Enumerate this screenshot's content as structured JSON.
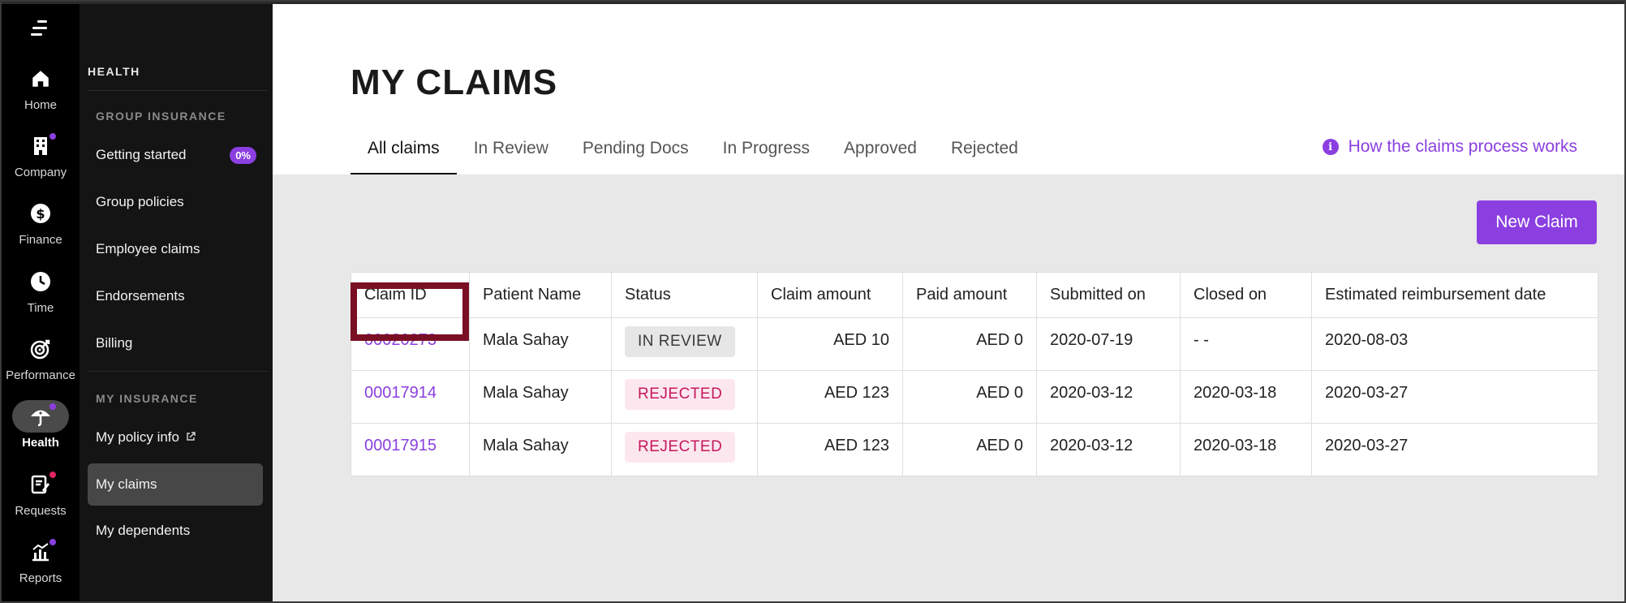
{
  "rail": {
    "items": [
      {
        "label": "Home",
        "icon": "home-icon",
        "dot": ""
      },
      {
        "label": "Company",
        "icon": "building-icon",
        "dot": "#8b3fe0"
      },
      {
        "label": "Finance",
        "icon": "dollar-icon",
        "dot": ""
      },
      {
        "label": "Time",
        "icon": "clock-icon",
        "dot": ""
      },
      {
        "label": "Performance",
        "icon": "target-icon",
        "dot": ""
      },
      {
        "label": "Health",
        "icon": "umbrella-icon",
        "dot": "#8b3fe0"
      },
      {
        "label": "Requests",
        "icon": "requests-icon",
        "dot": "#e0245e"
      },
      {
        "label": "Reports",
        "icon": "chart-icon",
        "dot": "#8b3fe0"
      }
    ],
    "active": "Health"
  },
  "subnav": {
    "title": "HEALTH",
    "group_section": "GROUP INSURANCE",
    "group_items": {
      "getting_started": "Getting started",
      "getting_started_badge": "0%",
      "group_policies": "Group policies",
      "employee_claims": "Employee claims",
      "endorsements": "Endorsements",
      "billing": "Billing"
    },
    "my_section": "MY INSURANCE",
    "my_items": {
      "policy_info": "My policy info",
      "my_claims": "My claims",
      "dependents": "My dependents"
    }
  },
  "main": {
    "title": "MY CLAIMS",
    "tabs": [
      "All claims",
      "In Review",
      "Pending Docs",
      "In Progress",
      "Approved",
      "Rejected"
    ],
    "active_tab": "All claims",
    "help_link": "How the claims process works",
    "new_claim_button": "New Claim"
  },
  "table": {
    "headers": [
      "Claim ID",
      "Patient Name",
      "Status",
      "Claim amount",
      "Paid amount",
      "Submitted on",
      "Closed on",
      "Estimated reimbursement date"
    ],
    "rows": [
      [
        "00020273",
        "Mala Sahay",
        "IN REVIEW",
        "AED 10",
        "AED 0",
        "2020-07-19",
        "- -",
        "2020-08-03"
      ],
      [
        "00017914",
        "Mala Sahay",
        "REJECTED",
        "AED 123",
        "AED 0",
        "2020-03-12",
        "2020-03-18",
        "2020-03-27"
      ],
      [
        "00017915",
        "Mala Sahay",
        "REJECTED",
        "AED 123",
        "AED 0",
        "2020-03-12",
        "2020-03-18",
        "2020-03-27"
      ]
    ]
  },
  "colors": {
    "accent": "#8b3fe0",
    "rejected_text": "#c4185b",
    "rejected_bg": "#fde7ef",
    "highlight": "#7a0f24"
  }
}
